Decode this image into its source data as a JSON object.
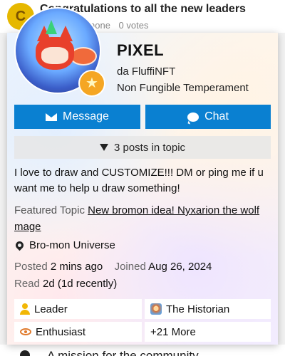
{
  "background": {
    "top_topic": {
      "icon_letter": "C",
      "title": "Congratulations to all the new leaders",
      "meta": [
        "none",
        "0 votes"
      ]
    },
    "bottom_topic": {
      "title": "A mission for the community"
    }
  },
  "user_card": {
    "username": "PIXEL",
    "full_name": "da FluffiNFT",
    "user_title": "Non Fungible Temperament",
    "avatar_icon": "fox-avatar",
    "flair_icon": "star-icon",
    "buttons": {
      "message_label": "Message",
      "chat_label": "Chat"
    },
    "posts_in_topic": "3 posts in topic",
    "bio": "I love to draw and CUSTOMIZE!!! DM or ping me if u want me to help u draw something!",
    "featured_topic": {
      "label": "Featured Topic",
      "link_text": "New bromon idea! Nyxarion the wolf mage"
    },
    "location": "Bro-mon Universe",
    "posted": {
      "label": "Posted",
      "value": "2 mins ago"
    },
    "joined": {
      "label": "Joined",
      "value": "Aug 26, 2024"
    },
    "read": {
      "label": "Read",
      "value": "2d (1d recently)"
    },
    "badges": [
      {
        "name": "Leader",
        "icon": "user-icon"
      },
      {
        "name": "The Historian",
        "icon": "historian-icon"
      },
      {
        "name": "Enthusiast",
        "icon": "eye-icon"
      },
      {
        "name": "+21 More",
        "icon": ""
      }
    ]
  },
  "colors": {
    "primary_button": "#0a80d1",
    "leader_badge": "#f2b705",
    "enthusiast_badge": "#e07a2c"
  }
}
